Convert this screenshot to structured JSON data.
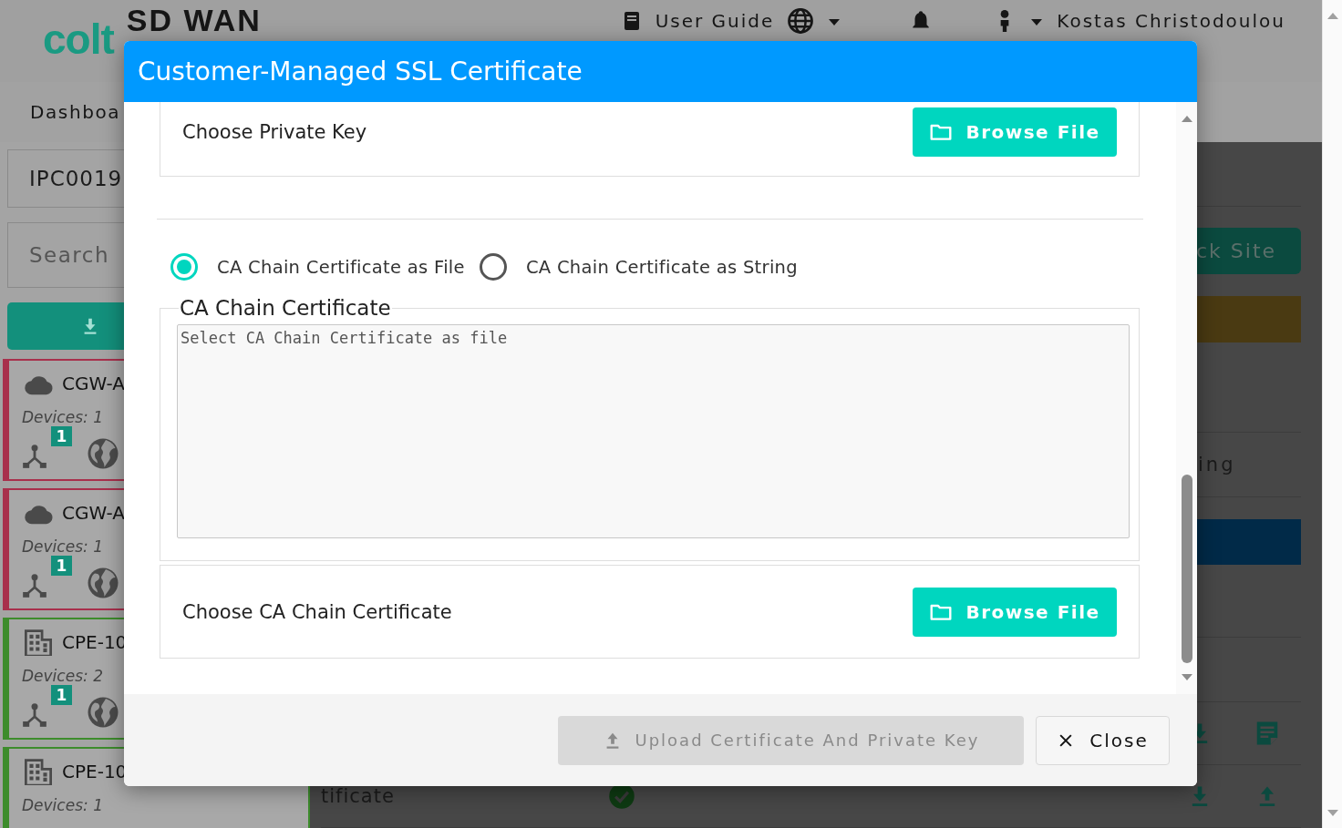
{
  "header": {
    "logo": "colt",
    "product": "SD WAN",
    "user_guide": "User Guide",
    "user": "Kostas Christodoulou",
    "nav": [
      "Dashboa"
    ]
  },
  "sidebar": {
    "site_field": "IPC0019",
    "search": {
      "placeholder": "Search"
    },
    "sites": [
      {
        "kind": "cloud",
        "name": "CGW-A",
        "devices": "Devices: 1",
        "badge": "1",
        "color": "#a8304c"
      },
      {
        "kind": "cloud",
        "name": "CGW-A",
        "devices": "Devices: 1",
        "badge": "1",
        "color": "#a8304c"
      },
      {
        "kind": "building",
        "name": "CPE-10",
        "devices": "Devices: 2",
        "badge": "1",
        "color": "#3d8c2c"
      },
      {
        "kind": "building",
        "name": "CPE-10",
        "devices": "Devices: 1",
        "color": "#3d8c2c"
      }
    ]
  },
  "main": {
    "lock_button": "ck Site",
    "section_label": "ing",
    "row_label": "tificate"
  },
  "modal": {
    "title": "Customer-Managed SSL Certificate",
    "private_key": {
      "label": "Choose Private Key",
      "button": "Browse File"
    },
    "ca_mode": [
      {
        "label": "CA Chain Certificate as File",
        "selected": true
      },
      {
        "label": "CA Chain Certificate as String",
        "selected": false
      }
    ],
    "ca_chain": {
      "legend": "CA Chain Certificate",
      "placeholder": "Select CA Chain Certificate as file"
    },
    "ca_file": {
      "label": "Choose CA Chain Certificate",
      "button": "Browse File"
    },
    "footer": {
      "upload": {
        "label": "Upload Certificate And Private Key",
        "disabled": true
      },
      "close": "Close"
    }
  }
}
